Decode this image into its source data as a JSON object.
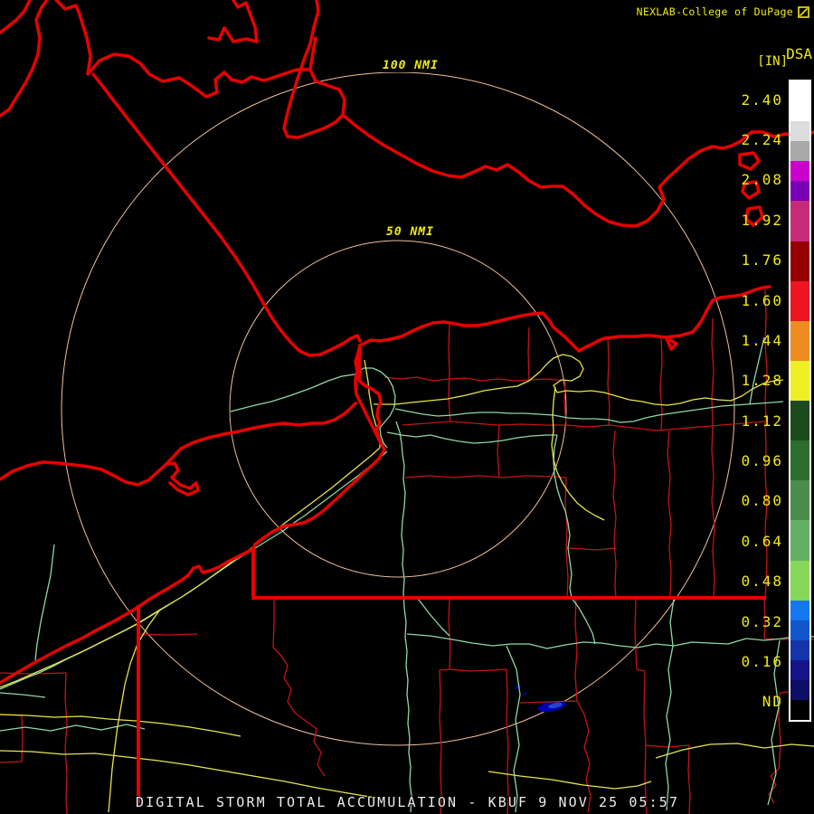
{
  "header": {
    "brand": "NEXLAB-College of DuPage",
    "logo_icon": "cod-logo-icon"
  },
  "scale": {
    "product_code": "DSA",
    "units_label": "[IN]",
    "labels": [
      "2.40",
      "2.24",
      "2.08",
      "1.92",
      "1.76",
      "1.60",
      "1.44",
      "1.28",
      "1.12",
      "0.96",
      "0.80",
      "0.64",
      "0.48",
      "0.32",
      "0.16",
      "ND"
    ],
    "segments": [
      {
        "color": "#ffffff",
        "units": 2
      },
      {
        "color": "#dcdcdc",
        "units": 1
      },
      {
        "color": "#a8a8a8",
        "units": 1
      },
      {
        "color": "#cc00cc",
        "units": 1
      },
      {
        "color": "#7a00b8",
        "units": 1
      },
      {
        "color": "#c82a7a",
        "units": 2
      },
      {
        "color": "#960000",
        "units": 2
      },
      {
        "color": "#ee1420",
        "units": 2
      },
      {
        "color": "#ee8c22",
        "units": 2
      },
      {
        "color": "#eeee24",
        "units": 2
      },
      {
        "color": "#1c4a1c",
        "units": 2
      },
      {
        "color": "#2c6c2c",
        "units": 2
      },
      {
        "color": "#4c8c4c",
        "units": 2
      },
      {
        "color": "#64b064",
        "units": 2
      },
      {
        "color": "#86d858",
        "units": 2
      },
      {
        "color": "#1478ee",
        "units": 1
      },
      {
        "color": "#1256cc",
        "units": 1
      },
      {
        "color": "#1434aa",
        "units": 1
      },
      {
        "color": "#141488",
        "units": 1
      },
      {
        "color": "#0e0e66",
        "units": 1
      },
      {
        "color": "#000000",
        "units": 1
      }
    ]
  },
  "map": {
    "range_rings": [
      {
        "label": "100 NMI"
      },
      {
        "label": "50 NMI"
      }
    ],
    "radar_echoes": [
      {
        "approx_value_in": "0.16",
        "color": "#0000b0",
        "location": "south of radar near 100 NMI ring"
      }
    ]
  },
  "footer": {
    "title": "DIGITAL STORM TOTAL ACCUMULATION - KBUF 9 NOV 25 05:57"
  },
  "palette": {
    "background": "#000000",
    "text_yellow": "#f0ea14",
    "text_white": "#ececec",
    "boundaries_red": "#e80000",
    "county_red": "#c41414",
    "road_green": "#8fd8a4",
    "road_yellow": "#e8e44c",
    "range_ring": "#f2c09c"
  }
}
